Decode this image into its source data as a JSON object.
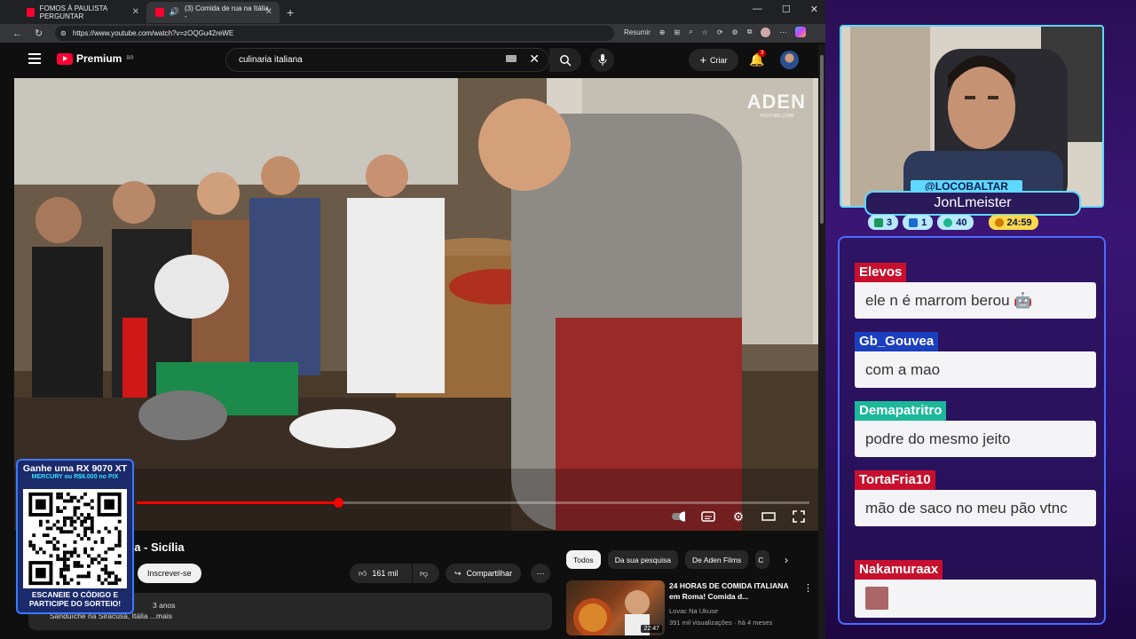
{
  "browser": {
    "tabs": [
      {
        "title": "FOMOS À PAULISTA PERGUNTAR"
      },
      {
        "title": "(3) Comida de rua na Itália -"
      }
    ],
    "url": "https://www.youtube.com/watch?v=zOQGu42reWE",
    "resumir": "Resumir"
  },
  "youtube": {
    "brand": "Premium",
    "region": "BR",
    "search_value": "culinaria italiana",
    "create_label": "Criar",
    "notif_count": "3",
    "video": {
      "watermark": "ADEN",
      "watermark_sub": "YOUTUBE.COM/",
      "progress": 0.3,
      "title_partial": "lia - Sicília",
      "subscribe_label": "Inscrever-se",
      "likes": "161 mil",
      "share_label": "Compartilhar",
      "desc_line1": "3 anos",
      "desc_line2": "Sanduíche na Siracusa, Itália ...mais"
    },
    "chips": [
      "Todos",
      "Da sua pesquisa",
      "De Aden Films",
      "C"
    ],
    "recommended": {
      "title": "24 HORAS DE COMIDA ITALIANA em Roma! Comida d...",
      "channel": "Lovac Na Ukuse",
      "meta": "391 mil visualizações · há 4 meses",
      "duration": "22:47"
    }
  },
  "promo": {
    "line1": "Ganhe uma RX 9070 XT",
    "line2": "MERCURY ou R$6.000 no PIX",
    "line3": "ESCANEIE O CÓDIGO E",
    "line4": "PARTICIPE DO SORTEIO!"
  },
  "stream": {
    "handle": "@LOCOBALTAR",
    "name": "JonLmeister",
    "stats": [
      "3",
      "1",
      "40"
    ],
    "timer": "24:59"
  },
  "chat": [
    {
      "user": "Elevos",
      "color": "#c8102e",
      "text": "ele n é marrom berou 🤖"
    },
    {
      "user": "Gb_Gouvea",
      "color": "#1a3fbf",
      "text": "com a mao"
    },
    {
      "user": "Demapatritro",
      "color": "#1bb89a",
      "text": "podre do mesmo jeito"
    },
    {
      "user": "TortaFria10",
      "color": "#c8102e",
      "text": "mão de saco no meu pão vtnc"
    },
    {
      "user": "Nakamuraax",
      "color": "#c8102e",
      "text": ""
    }
  ]
}
